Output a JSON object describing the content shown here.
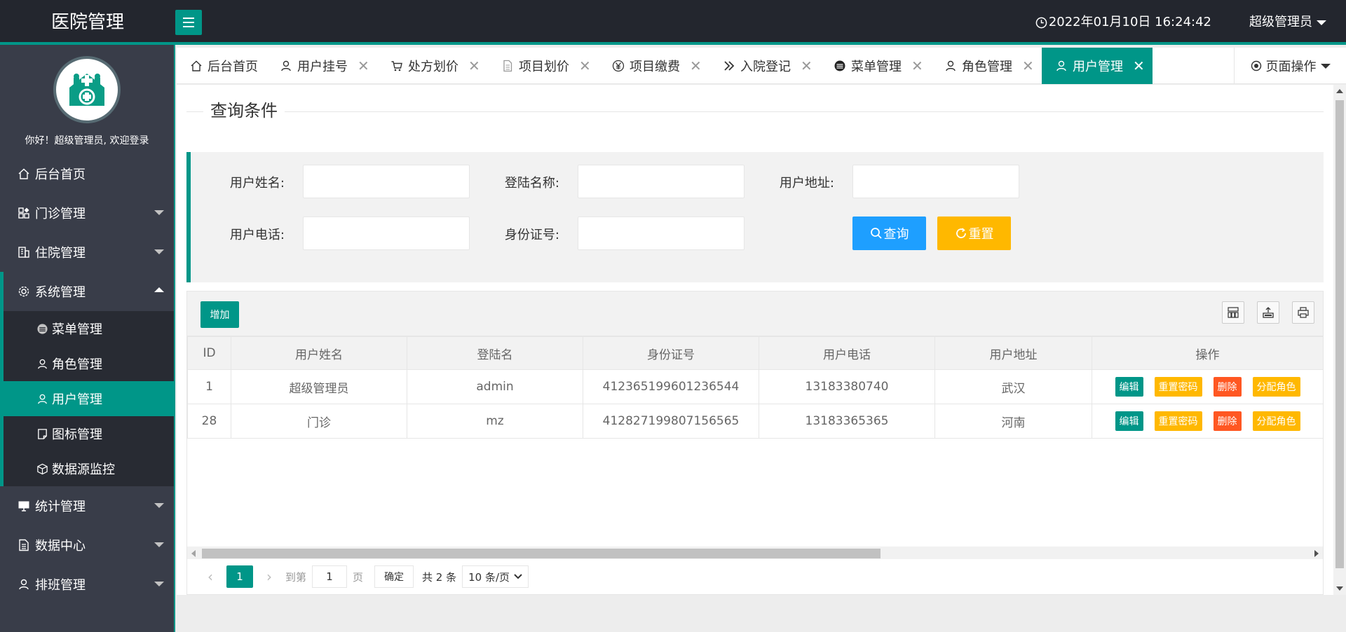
{
  "header": {
    "logo": "医院管理",
    "datetime": "2022年01月10日 16:24:42",
    "user": "超级管理员"
  },
  "sidebar": {
    "welcome": "你好！超级管理员, 欢迎登录",
    "items": [
      {
        "label": "后台首页",
        "icon": "home-icon"
      },
      {
        "label": "门诊管理",
        "icon": "apps-icon"
      },
      {
        "label": "住院管理",
        "icon": "building-icon"
      },
      {
        "label": "系统管理",
        "icon": "gear-icon"
      },
      {
        "label": "统计管理",
        "icon": "monitor-icon"
      },
      {
        "label": "数据中心",
        "icon": "document-icon"
      },
      {
        "label": "排班管理",
        "icon": "user-icon"
      }
    ],
    "sub_items": [
      {
        "label": "菜单管理",
        "icon": "menu-circle-icon"
      },
      {
        "label": "角色管理",
        "icon": "user-icon"
      },
      {
        "label": "用户管理",
        "icon": "user-icon"
      },
      {
        "label": "图标管理",
        "icon": "note-icon"
      },
      {
        "label": "数据源监控",
        "icon": "cube-icon"
      }
    ]
  },
  "tabs": [
    {
      "label": "后台首页",
      "icon": "home-icon",
      "closable": false
    },
    {
      "label": "用户挂号",
      "icon": "user-icon",
      "closable": true
    },
    {
      "label": "处方划价",
      "icon": "cart-icon",
      "closable": true
    },
    {
      "label": "项目划价",
      "icon": "file-icon",
      "closable": true
    },
    {
      "label": "项目缴费",
      "icon": "yen-icon",
      "closable": true
    },
    {
      "label": "入院登记",
      "icon": "double-arrow-icon",
      "closable": true
    },
    {
      "label": "菜单管理",
      "icon": "menu-circle-icon",
      "closable": true
    },
    {
      "label": "角色管理",
      "icon": "user-icon",
      "closable": true
    },
    {
      "label": "用户管理",
      "icon": "user-icon",
      "closable": true,
      "active": true
    }
  ],
  "page_ops": "页面操作",
  "query": {
    "legend": "查询条件",
    "fields": {
      "username": {
        "label": "用户姓名:",
        "value": ""
      },
      "login": {
        "label": "登陆名称:",
        "value": ""
      },
      "address": {
        "label": "用户地址:",
        "value": ""
      },
      "phone": {
        "label": "用户电话:",
        "value": ""
      },
      "idcard": {
        "label": "身份证号:",
        "value": ""
      }
    },
    "search_label": "查询",
    "reset_label": "重置"
  },
  "table": {
    "add_label": "增加",
    "columns": [
      "ID",
      "用户姓名",
      "登陆名",
      "身份证号",
      "用户电话",
      "用户地址",
      "操作"
    ],
    "rows": [
      {
        "id": "1",
        "name": "超级管理员",
        "login": "admin",
        "idcard": "412365199601236544",
        "phone": "13183380740",
        "address": "武汉"
      },
      {
        "id": "28",
        "name": "门诊",
        "login": "mz",
        "idcard": "412827199807156565",
        "phone": "13183365365",
        "address": "河南"
      }
    ],
    "actions": {
      "edit": "编辑",
      "reset_pwd": "重置密码",
      "delete": "删除",
      "assign_role": "分配角色"
    }
  },
  "pager": {
    "current": "1",
    "goto_label": "到第",
    "goto_value": "1",
    "page_unit": "页",
    "confirm": "确定",
    "total": "共 2 条",
    "page_size": "10 条/页"
  },
  "colors": {
    "primary": "#009688",
    "header_bg": "#23262e",
    "sidebar_bg": "#393d49",
    "search_btn": "#1e9fff",
    "warn": "#ffb800",
    "danger": "#ff5722"
  }
}
